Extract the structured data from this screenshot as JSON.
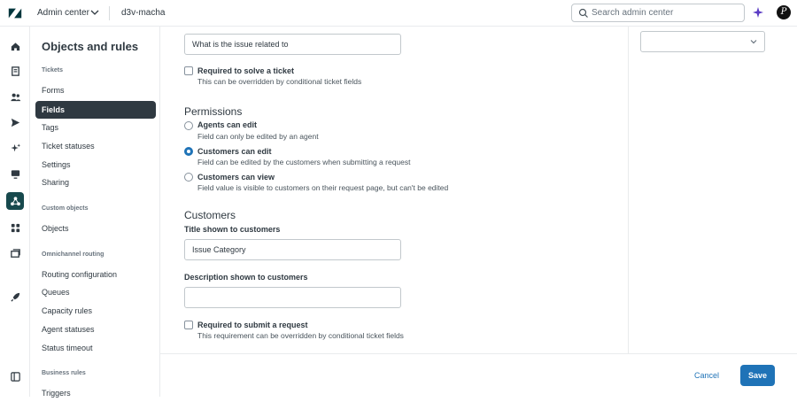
{
  "header": {
    "app_name": "Admin center",
    "account": "d3v-macha",
    "search_placeholder": "Search admin center"
  },
  "nav": {
    "title": "Objects and rules",
    "sections": {
      "tickets": "Tickets",
      "custom_objects": "Custom objects",
      "omnichannel": "Omnichannel routing",
      "business_rules": "Business rules"
    },
    "items": {
      "forms": "Forms",
      "fields": "Fields",
      "tags": "Tags",
      "ticket_statuses": "Ticket statuses",
      "settings": "Settings",
      "sharing": "Sharing",
      "objects": "Objects",
      "routing_configuration": "Routing configuration",
      "queues": "Queues",
      "capacity_rules": "Capacity rules",
      "agent_statuses": "Agent statuses",
      "status_timeout": "Status timeout",
      "triggers": "Triggers"
    }
  },
  "form": {
    "description_value": "What is the issue related to",
    "required_solve": {
      "label": "Required to solve a ticket",
      "hint": "This can be overridden by conditional ticket fields",
      "checked": false
    },
    "permissions": {
      "heading": "Permissions",
      "options": [
        {
          "label": "Agents can edit",
          "hint": "Field can only be edited by an agent",
          "checked": false
        },
        {
          "label": "Customers can edit",
          "hint": "Field can be edited by the customers when submitting a request",
          "checked": true
        },
        {
          "label": "Customers can view",
          "hint": "Field value is visible to customers on their request page, but can't be edited",
          "checked": false
        }
      ]
    },
    "customers": {
      "heading": "Customers",
      "title_label": "Title shown to customers",
      "title_value": "Issue Category",
      "description_label": "Description shown to customers",
      "description_value": "",
      "required_submit": {
        "label": "Required to submit a request",
        "hint": "This requirement can be overridden by conditional ticket fields",
        "checked": false
      }
    }
  },
  "footer": {
    "cancel_label": "Cancel",
    "save_label": "Save"
  },
  "colors": {
    "accent": "#1f73b7",
    "nav_active": "#2f3941",
    "rail_active": "#17494d"
  }
}
